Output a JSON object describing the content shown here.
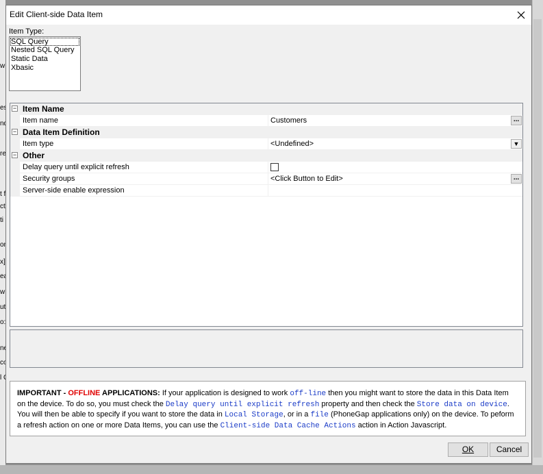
{
  "dialog": {
    "title": "Edit Client-side Data Item"
  },
  "item_type": {
    "label": "Item Type:",
    "options": [
      "SQL Query",
      "Nested SQL Query",
      "Static Data",
      "Xbasic"
    ],
    "selected": "SQL Query"
  },
  "grid": {
    "cat_item_name": "Item Name",
    "item_name_label": "Item name",
    "item_name_value": "Customers",
    "cat_definition": "Data Item Definition",
    "item_type_label": "Item type",
    "item_type_value": "<Undefined>",
    "cat_other": "Other",
    "delay_label": "Delay query until explicit refresh",
    "delay_checked": false,
    "security_label": "Security groups",
    "security_value": "<Click Button to Edit>",
    "server_expr_label": "Server-side enable expression",
    "server_expr_value": "",
    "ellipsis": "...",
    "collapse_glyph": "−",
    "dropdown_glyph": "▼"
  },
  "notice": {
    "important": "IMPORTANT - ",
    "offline": "OFFLINE",
    "applications": " APPLICATIONS:",
    "t1": " If your application is designed to work ",
    "c1": "off-line",
    "t2": " then you might want to store the data in this Data Item on the device. To do so, you must check the ",
    "c2": "Delay query until explicit refresh",
    "t3": " property and then check the ",
    "c3": "Store data on device",
    "t4": ". You will then be able to specify if you want to store the data in ",
    "c4": "Local Storage",
    "t5": ", or in a ",
    "c5": "file",
    "t6": " (PhoneGap applications only) on the device. To peform a refresh action on one or more Data Items, you can use the ",
    "c6": "Client-side Data Cache Actions",
    "t7": " action in Action Javascript."
  },
  "buttons": {
    "ok": "OK",
    "cancel": "Cancel"
  },
  "background": {
    "fragments": [
      "w",
      "es",
      "nd",
      "re",
      "t f",
      "ct",
      "ti",
      "on",
      "x]",
      "ea",
      "w",
      "ut",
      "o:",
      "ne",
      "co",
      "l C"
    ]
  }
}
